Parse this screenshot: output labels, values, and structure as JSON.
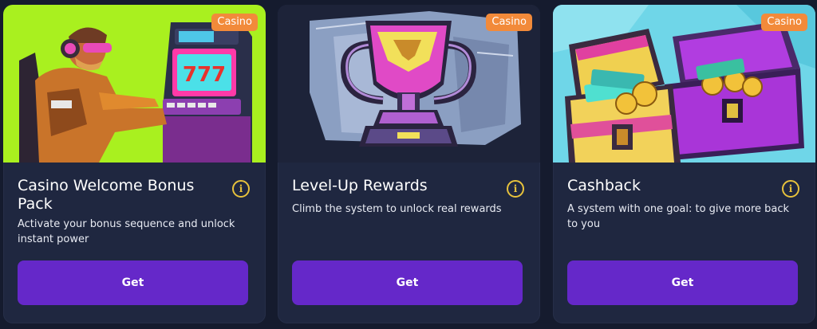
{
  "cards": [
    {
      "badge": "Casino",
      "title": "Casino Welcome Bonus Pack",
      "description": "Activate your bonus sequence and unlock instant power",
      "button": "Get",
      "art_background": "#a9f01f"
    },
    {
      "badge": "Casino",
      "title": "Level-Up Rewards",
      "description": "Climb the system to unlock real rewards",
      "button": "Get",
      "art_background": "#1c2238"
    },
    {
      "badge": "Casino",
      "title": "Cashback",
      "description": "A system with one goal: to give more back to you",
      "button": "Get",
      "art_background": "#6fd6e8"
    }
  ],
  "colors": {
    "page_bg": "#151b2e",
    "card_bg": "#1f2740",
    "badge": "#f28a3a",
    "button": "#6528c9",
    "info_icon": "#e7c23c"
  },
  "icons": {
    "info": "info-icon",
    "slot_machine": "slot-machine-illustration",
    "trophy": "trophy-illustration",
    "treasure": "treasure-chest-illustration"
  },
  "slot_reels": "777"
}
